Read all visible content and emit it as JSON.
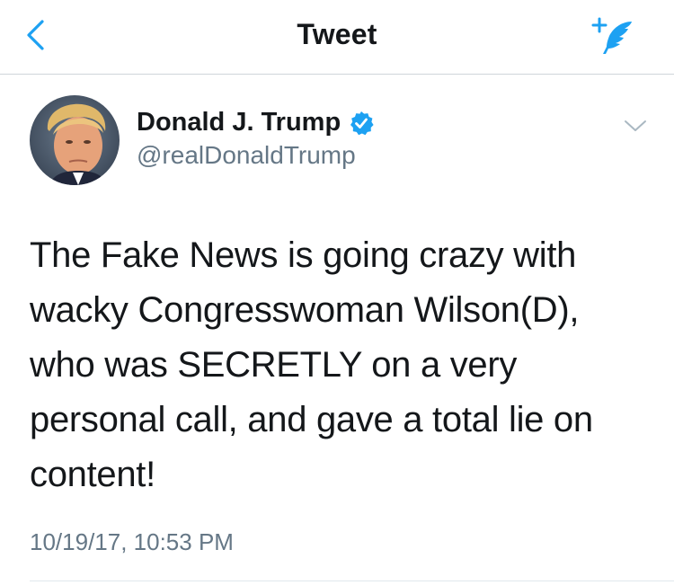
{
  "nav": {
    "title": "Tweet",
    "back_icon": "chevron-left-icon",
    "compose_icon": "compose-feather-icon",
    "accent_color": "#1da1f2"
  },
  "tweet": {
    "author_name": "Donald J. Trump",
    "author_handle": "@realDonaldTrump",
    "verified": true,
    "text_lines": [
      "The Fake News is going crazy with",
      "wacky Congresswoman Wilson(D),",
      "who was SECRETLY on a very",
      "personal call, and gave a total lie on",
      "content!"
    ],
    "timestamp": "10/19/17, 10:53 PM"
  },
  "colors": {
    "text_primary": "#14171a",
    "text_secondary": "#657786",
    "divider": "#cfd5da"
  }
}
